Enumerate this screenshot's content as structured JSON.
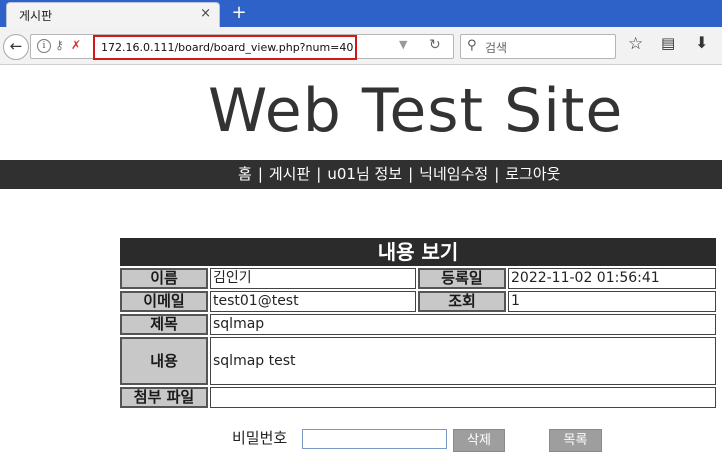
{
  "browser": {
    "tab_title": "게시판",
    "tab_close": "×",
    "new_tab": "+",
    "url": "172.16.0.111/board/board_view.php?num=40",
    "search_placeholder": "검색"
  },
  "site": {
    "title": "Web Test Site",
    "menu": [
      "홈",
      "게시판",
      "u01님 정보",
      "닉네임수정",
      "로그아웃"
    ]
  },
  "board": {
    "header": "내용 보기",
    "labels": {
      "name": "이름",
      "reg_date": "등록일",
      "email": "이메일",
      "views": "조회",
      "subject": "제목",
      "content": "내용",
      "attachment": "첨부 파일"
    },
    "values": {
      "name": "김인기",
      "reg_date": "2022-11-02 01:56:41",
      "email": "test01@test",
      "views": "1",
      "subject": "sqlmap",
      "content": "sqlmap test",
      "attachment": ""
    }
  },
  "form": {
    "password_label": "비밀번호",
    "password_value": "",
    "delete_button": "삭제",
    "list_button": "목록"
  }
}
